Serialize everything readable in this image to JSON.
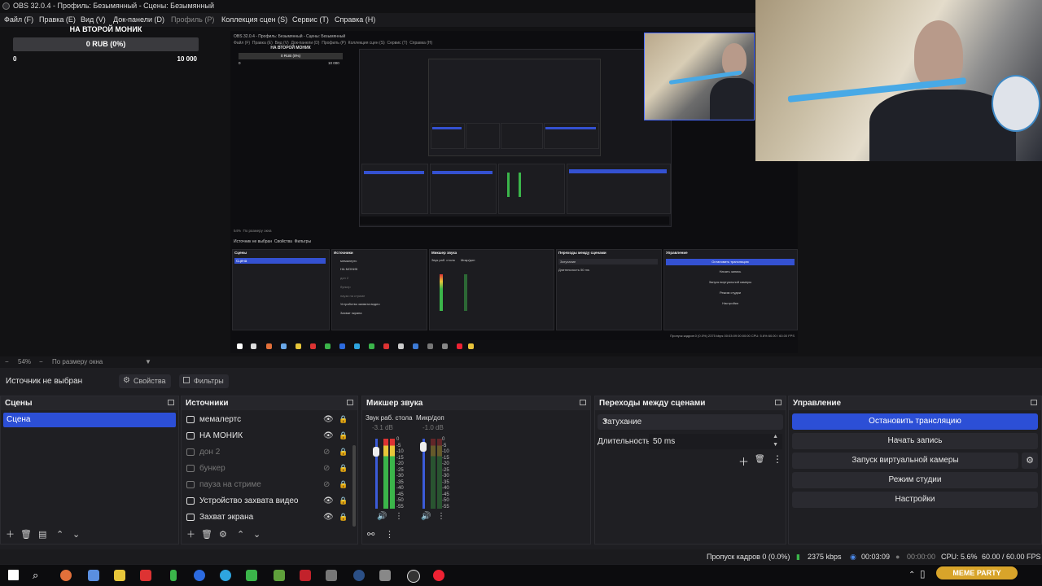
{
  "window": {
    "title": "OBS 32.0.4 - Профиль: Безымянный - Сцены: Безымянный"
  },
  "menu": [
    "Файл (F)",
    "Правка (E)",
    "Вид (V)",
    "Док-панели (D)",
    "Профиль (P)",
    "Коллекция сцен (S)",
    "Сервис (T)",
    "Справка (H)"
  ],
  "goal_widget": {
    "title": "НА ВТОРОЙ МОНИК",
    "amount": "0 RUB (0%)",
    "min": "0",
    "max": "10 000",
    "progress": 0
  },
  "zoom": {
    "percent": "54%",
    "mode": "По размеру окна"
  },
  "source_toolbar": {
    "label": "Источник не выбран",
    "properties": "Свойства",
    "filters": "Фильтры"
  },
  "scenes": {
    "title": "Сцены",
    "items": [
      "Сцена"
    ]
  },
  "sources": {
    "title": "Источники",
    "items": [
      {
        "name": "мемалертс",
        "visible": true
      },
      {
        "name": "НА МОНИК",
        "visible": true
      },
      {
        "name": "дон 2",
        "visible": false
      },
      {
        "name": "бункер",
        "visible": false
      },
      {
        "name": "пауза на стриме",
        "visible": false
      },
      {
        "name": "Устройство захвата видео",
        "visible": true
      },
      {
        "name": "Захват экрана",
        "visible": true
      }
    ]
  },
  "mixer": {
    "title": "Микшер звука",
    "channels": [
      {
        "name": "Звук раб. стола",
        "db": "-3.1 dB"
      },
      {
        "name": "Микр/доп",
        "db": "-1.0 dB"
      }
    ],
    "ticks": [
      "0",
      "-5",
      "-10",
      "-15",
      "-20",
      "-25",
      "-30",
      "-35",
      "-40",
      "-45",
      "-50",
      "-55",
      "-60"
    ]
  },
  "transitions": {
    "title": "Переходы между сценами",
    "selected": "Затухание",
    "duration_label": "Длительность",
    "duration": "50 ms"
  },
  "controls": {
    "title": "Управление",
    "buttons": [
      "Остановить трансляцию",
      "Начать запись",
      "Запуск виртуальной камеры",
      "Режим студии",
      "Настройки"
    ]
  },
  "status": {
    "dropped": "Пропуск кадров 0 (0.0%)",
    "bitrate": "2375 kbps",
    "stream_time": "00:03:09",
    "rec_time": "00:00:00",
    "cpu": "CPU: 5.6%",
    "fps": "60.00 / 60.00 FPS"
  },
  "nested_preview": {
    "title": "OBS 32.0.4 - Профиль: Безымянный - Сцены: Безымянный",
    "widget_title": "НА ВТОРОЙ МОНИК",
    "widget_amount": "0 RUB (0%)",
    "widget_min": "0",
    "widget_max": "10 000",
    "menu": [
      "Файл (F)",
      "Правка (E)",
      "Вид (V)",
      "Док-панели (D)",
      "Профиль (P)",
      "Коллекция сцен (S)",
      "Сервис (T)",
      "Справка (H)"
    ],
    "zoom_percent": "54%",
    "zoom_mode": "По размеру окна",
    "source_none": "Источник не выбран",
    "properties": "Свойства",
    "filters": "Фильтры",
    "scenes_title": "Сцены",
    "scene": "Сцена",
    "sources_title": "Источники",
    "sources": [
      "мемалертс",
      "НА МОНИК",
      "дон 2",
      "бункер",
      "пауза на стриме",
      "Устройство захвата видео",
      "Захват экрана"
    ],
    "mixer_title": "Микшер звука",
    "mixer_ch1": "Звук раб. стола",
    "mixer_ch2": "Микр/доп",
    "transitions_title": "Переходы между сценами",
    "transition": "Затухание",
    "duration_label": "Длительность",
    "duration": "50 ms",
    "controls_title": "Управление",
    "controls": [
      "Остановить трансляцию",
      "Начать запись",
      "Запуск виртуальной камеры",
      "Режим студии",
      "Настройки"
    ],
    "status": "Пропуск кадров 0 (0.0%)   2375 kbps   00:03:09   00:00:00   CPU: 5.6%   60.00 / 60.00 FPS"
  },
  "overlay_badge": "MEME PARTY",
  "accent": "#2c4fd6"
}
